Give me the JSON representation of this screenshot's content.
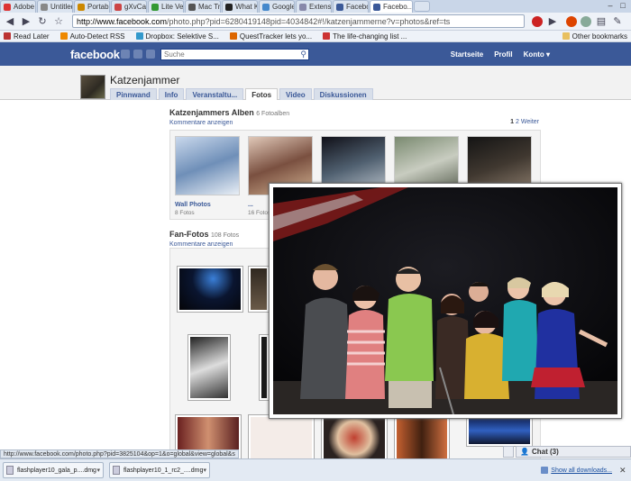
{
  "browser": {
    "tabs": [
      {
        "label": "Adobe ...",
        "color": "#d33"
      },
      {
        "label": "Untitled",
        "color": "#888"
      },
      {
        "label": "Portabl...",
        "color": "#c80"
      },
      {
        "label": "gXvCar...",
        "color": "#c44"
      },
      {
        "label": "Lite Ve...",
        "color": "#393"
      },
      {
        "label": "Mac Tri...",
        "color": "#555"
      },
      {
        "label": "What K...",
        "color": "#222"
      },
      {
        "label": "Google ...",
        "color": "#48c"
      },
      {
        "label": "Extensi...",
        "color": "#88a"
      },
      {
        "label": "Facebo...",
        "color": "#3b5998"
      },
      {
        "label": "Facebo...",
        "color": "#3b5998",
        "active": true
      }
    ],
    "url_host": "http://www.facebook.com",
    "url_path": "/photo.php?pid=6280419148pid=4034842#!/katzenjammerne?v=photos&ref=ts",
    "bookmarks": [
      {
        "label": "Read Later",
        "color": "#b33"
      },
      {
        "label": "Auto-Detect RSS",
        "color": "#e80"
      },
      {
        "label": "Dropbox: Selektive S...",
        "color": "#39c"
      },
      {
        "label": "QuestTracker lets yo...",
        "color": "#d60"
      },
      {
        "label": "The life-changing list ...",
        "color": "#c33"
      }
    ],
    "other_bookmarks": "Other bookmarks"
  },
  "fb": {
    "logo": "facebook",
    "search_placeholder": "Suche",
    "nav": [
      "Startseite",
      "Profil",
      "Konto ▾"
    ],
    "profile_name": "Katzenjammer",
    "tabs": [
      "Pinnwand",
      "Info",
      "Veranstaltu...",
      "Fotos",
      "Video",
      "Diskussionen"
    ],
    "active_tab": 3
  },
  "albums_section": {
    "title": "Katzenjammers Alben",
    "count": "6 Fotoalben",
    "comments_link": "Kommentare anzeigen",
    "pager_current": "1",
    "pager_next": "2",
    "pager_more": "Weiter",
    "items": [
      {
        "caption": "Wall Photos",
        "sub": "8 Fotos",
        "colors": [
          "#c9d8ec",
          "#6f8fb8",
          "#e8eef5"
        ]
      },
      {
        "caption": "...",
        "sub": "16 Fotos",
        "colors": [
          "#e0c8b8",
          "#7a5040",
          "#d0b090"
        ]
      },
      {
        "caption": "",
        "sub": "",
        "colors": [
          "#101018",
          "#506070",
          "#c0c8d0"
        ]
      },
      {
        "caption": "",
        "sub": "",
        "colors": [
          "#7a8a70",
          "#c8ccc0",
          "#505848"
        ]
      },
      {
        "caption": "",
        "sub": "",
        "colors": [
          "#141414",
          "#403830",
          "#908070"
        ]
      }
    ]
  },
  "fan_section": {
    "title": "Fan-Fotos",
    "count": "108 Fotos",
    "comments_link": "Kommentare anzeigen"
  },
  "chat": {
    "label": "Chat (3)"
  },
  "status_url": "http://www.facebook.com/photo.php?pid=3825104&op=1&o=global&view=global&s",
  "downloads": [
    {
      "label": "flashplayer10_gala_p....dmg"
    },
    {
      "label": "flashplayer10_1_rc2_....dmg"
    }
  ],
  "show_all_downloads": "Show all downloads..."
}
